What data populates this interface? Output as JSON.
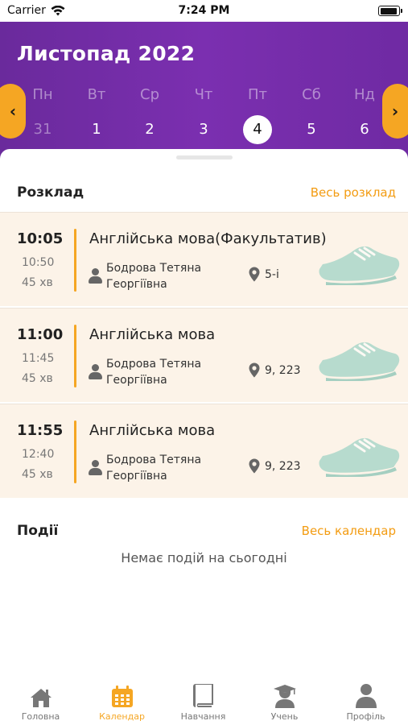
{
  "status_bar": {
    "carrier": "Carrier",
    "time": "7:24 PM"
  },
  "header": {
    "month": "Листопад 2022",
    "prev_icon": "chevron-left-icon",
    "next_icon": "chevron-right-icon",
    "days": [
      {
        "name": "Пн",
        "num": "31"
      },
      {
        "name": "Вт",
        "num": "1"
      },
      {
        "name": "Ср",
        "num": "2"
      },
      {
        "name": "Чт",
        "num": "3"
      },
      {
        "name": "Пт",
        "num": "4"
      },
      {
        "name": "Сб",
        "num": "5"
      },
      {
        "name": "Нд",
        "num": "6"
      }
    ],
    "selected_day": "4"
  },
  "schedule": {
    "title": "Розклад",
    "link": "Весь розклад",
    "lessons": [
      {
        "start": "10:05",
        "end": "10:50",
        "duration": "45 хв",
        "subject": "Англійська мова(Факультатив)",
        "teacher_line1": "Бодрова Тетяна",
        "teacher_line2": "Георгіївна",
        "room": "5-і"
      },
      {
        "start": "11:00",
        "end": "11:45",
        "duration": "45 хв",
        "subject": "Англійська мова",
        "teacher_line1": "Бодрова Тетяна",
        "teacher_line2": "Георгіївна",
        "room": "9, 223"
      },
      {
        "start": "11:55",
        "end": "12:40",
        "duration": "45 хв",
        "subject": "Англійська мова",
        "teacher_line1": "Бодрова Тетяна",
        "teacher_line2": "Георгіївна",
        "room": "9, 223"
      }
    ]
  },
  "events": {
    "title": "Події",
    "link": "Весь календар",
    "empty": "Немає подій на сьогодні"
  },
  "tabbar": {
    "tabs": [
      {
        "label": "Головна",
        "icon": "home-icon"
      },
      {
        "label": "Календар",
        "icon": "calendar-icon"
      },
      {
        "label": "Навчання",
        "icon": "book-icon"
      },
      {
        "label": "Учень",
        "icon": "student-icon"
      },
      {
        "label": "Профіль",
        "icon": "profile-icon"
      }
    ],
    "active": "Календар"
  },
  "colors": {
    "header": "#7b2fb0",
    "accent": "#f5a623",
    "lesson_bg": "#fcf3e8",
    "shoe": "#7fc9b9"
  }
}
